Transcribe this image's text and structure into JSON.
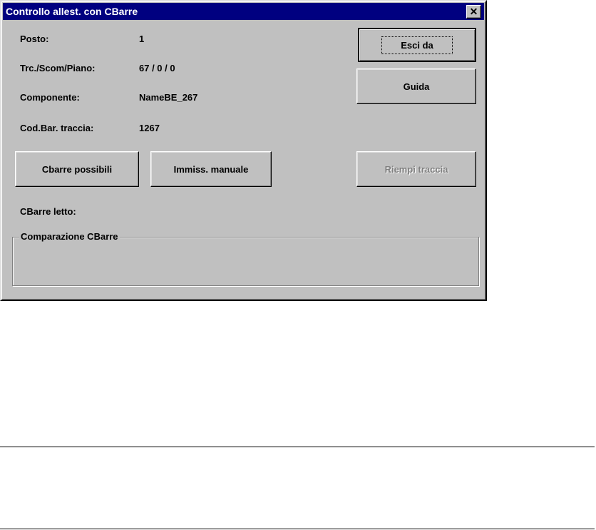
{
  "window": {
    "title": "Controllo allest. con CBarre",
    "close_glyph": "✕"
  },
  "fields": {
    "posto_label": "Posto:",
    "posto_value": "1",
    "traccia_label": "Trc./Scom/Piano:",
    "traccia_value": "67 / 0 / 0",
    "componente_label": "Componente:",
    "componente_value": "NameBE_267",
    "codbar_label": "Cod.Bar. traccia:",
    "codbar_value": "1267",
    "cbarre_letto_label": "CBarre letto:"
  },
  "buttons": {
    "esci": "Esci da",
    "guida": "Guida",
    "cbarre_possibili": "Cbarre possibili",
    "immiss_manuale": "Immiss. manuale",
    "riempi_traccia": "Riempi traccia"
  },
  "groupbox": {
    "label": "Comparazione CBarre"
  }
}
